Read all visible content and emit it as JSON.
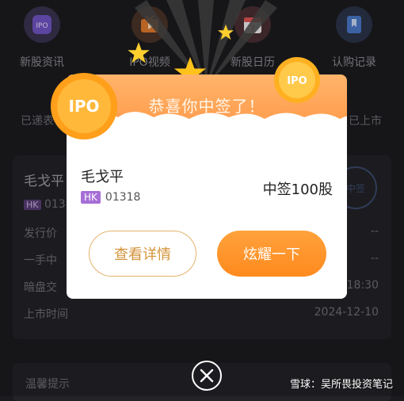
{
  "nav": {
    "items": [
      {
        "label": "新股资讯",
        "icon": "ipo-news-icon"
      },
      {
        "label": "IPO视频",
        "icon": "video-tv-icon"
      },
      {
        "label": "新股日历",
        "icon": "calendar-icon"
      },
      {
        "label": "认购记录",
        "icon": "bookmark-icon"
      }
    ]
  },
  "sub_tabs": {
    "left": "已递表",
    "right": "已上市"
  },
  "background_card": {
    "name": "毛戈平",
    "market": "HK",
    "code_partial": "013",
    "rows": [
      {
        "label": "发行价",
        "value": "--"
      },
      {
        "label": "一手中",
        "value": "--"
      },
      {
        "label": "暗盘交",
        "value": "18:30"
      },
      {
        "label": "上市时间",
        "value": "2024-12-10"
      }
    ],
    "stamp": "中签"
  },
  "tip_bar": {
    "label": "温馨提示"
  },
  "modal": {
    "coin_text": "IPO",
    "banner_title": "恭喜你中签了！",
    "stock_name": "毛戈平",
    "market_badge": "HK",
    "stock_code": "01318",
    "result": "中签100股",
    "detail_button": "查看详情",
    "share_button": "炫耀一下"
  },
  "close_icon": "close-circle-icon",
  "watermark": "雪球：吴所畏投资笔记",
  "colors": {
    "accent_orange": "#ff8a1e",
    "detail_border": "#e2b36a",
    "hk_purple": "#a66fd6",
    "background": "#1b1b1f"
  }
}
